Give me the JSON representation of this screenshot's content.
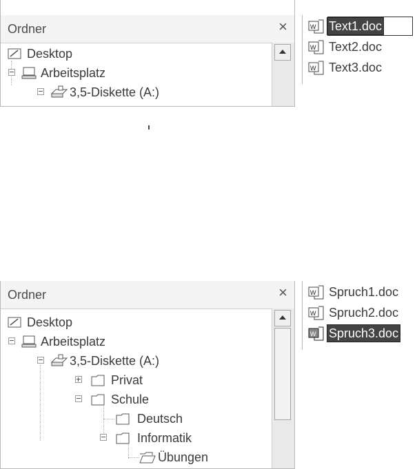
{
  "top": {
    "folder_pane": {
      "title": "Ordner",
      "close": "×",
      "tree": [
        {
          "label": "Desktop",
          "icon": "desktop-icon"
        },
        {
          "label": "Arbeitsplatz",
          "icon": "computer-icon",
          "expander": "minus"
        },
        {
          "label": "3,5-Diskette (A:)",
          "icon": "floppy-drive-icon",
          "expander": "minus"
        }
      ]
    },
    "file_pane": {
      "files": [
        {
          "label": "Text1.doc",
          "icon": "word-document-icon",
          "state": "rename"
        },
        {
          "label": "Text2.doc",
          "icon": "word-document-icon"
        },
        {
          "label": "Text3.doc",
          "icon": "word-document-icon"
        }
      ]
    }
  },
  "bottom": {
    "folder_pane": {
      "title": "Ordner",
      "close": "×",
      "tree": [
        {
          "label": "Desktop",
          "icon": "desktop-icon"
        },
        {
          "label": "Arbeitsplatz",
          "icon": "computer-icon",
          "expander": "minus"
        },
        {
          "label": "3,5-Diskette (A:)",
          "icon": "floppy-drive-icon",
          "expander": "minus"
        },
        {
          "label": "Privat",
          "icon": "folder-icon",
          "expander": "plus"
        },
        {
          "label": "Schule",
          "icon": "folder-icon",
          "expander": "minus"
        },
        {
          "label": "Deutsch",
          "icon": "folder-icon"
        },
        {
          "label": "Informatik",
          "icon": "folder-icon",
          "expander": "minus"
        },
        {
          "label": "Übungen",
          "icon": "open-folder-icon"
        }
      ]
    },
    "file_pane": {
      "files": [
        {
          "label": "Spruch1.doc",
          "icon": "word-document-icon"
        },
        {
          "label": "Spruch2.doc",
          "icon": "word-document-icon"
        },
        {
          "label": "Spruch3.doc",
          "icon": "word-document-icon",
          "state": "selected"
        }
      ]
    }
  },
  "colors": {
    "selection": "#444444",
    "pane_border": "#b8b8b8",
    "header_bg": "#f4f4f4"
  }
}
